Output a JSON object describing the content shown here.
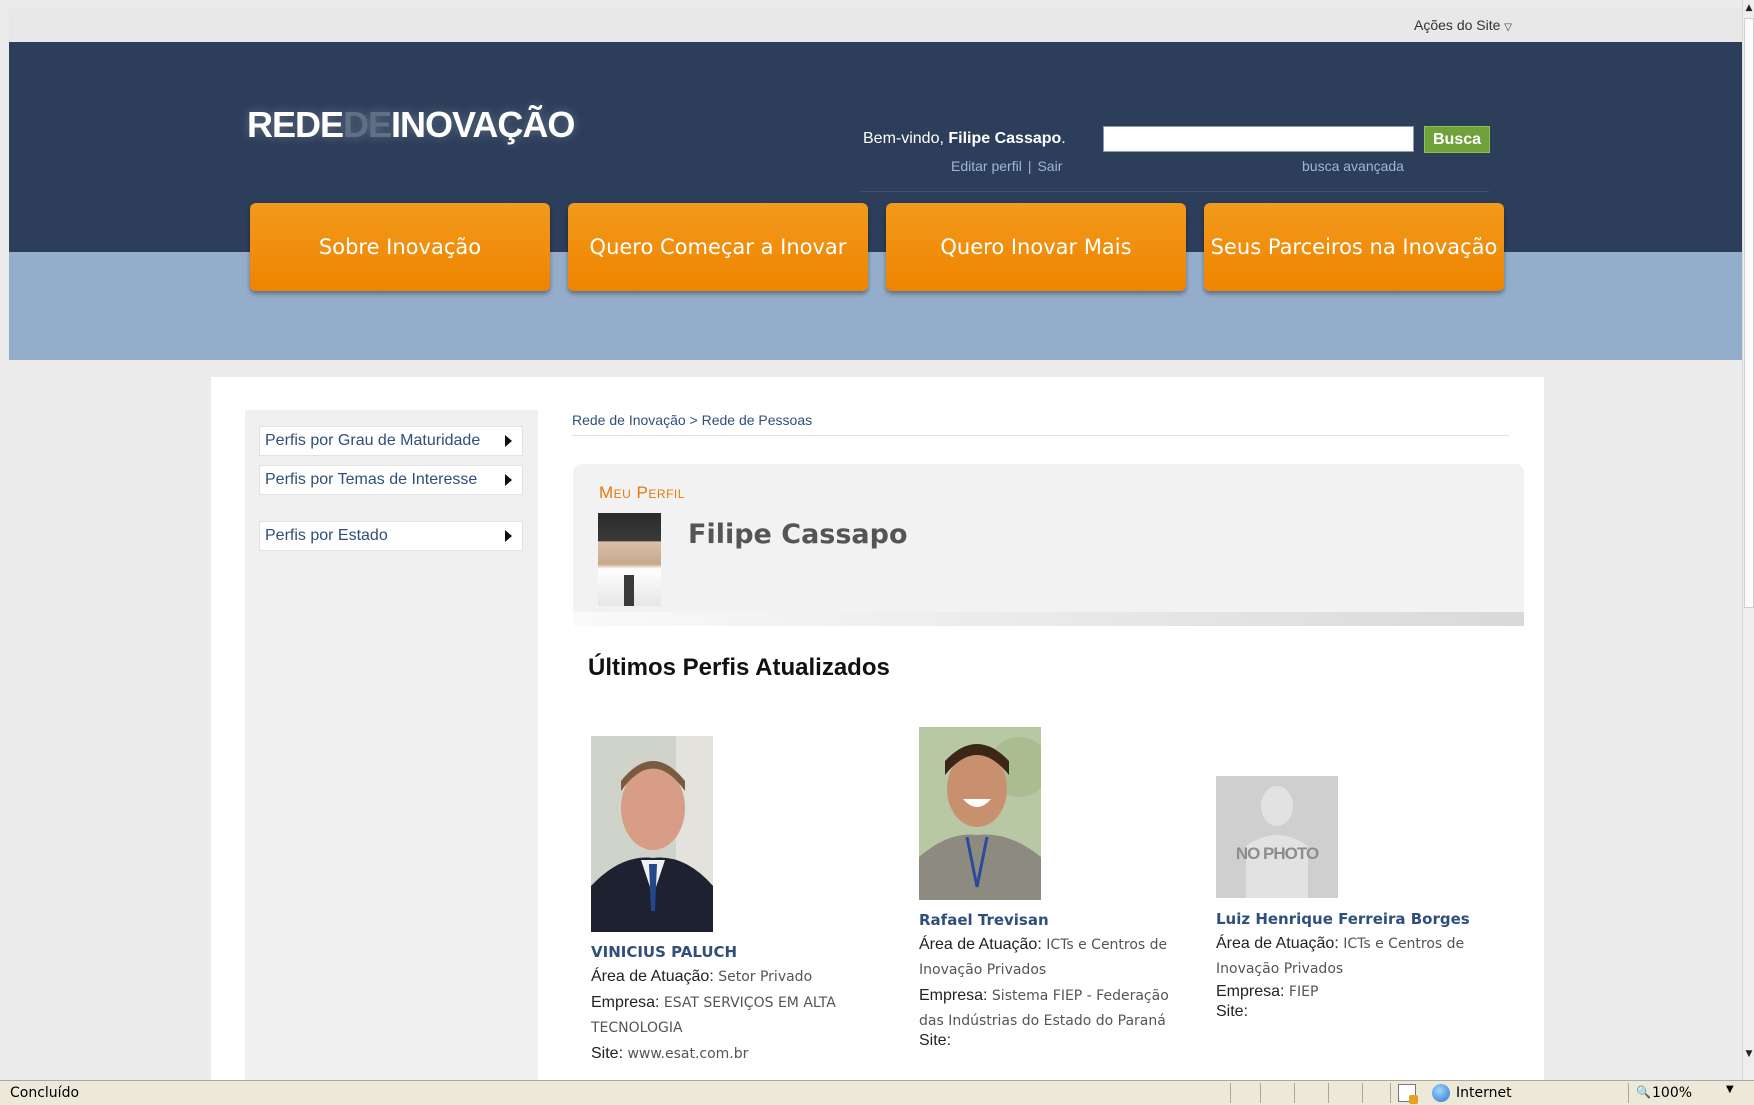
{
  "site_actions": "Ações do Site",
  "logo": {
    "part1": "REDE",
    "part2": "DE",
    "part3": "INOVAÇÃO"
  },
  "welcome": {
    "prefix": "Bem-vindo, ",
    "user": "Filipe Cassapo",
    "suffix": "."
  },
  "user_links": {
    "edit": "Editar perfil",
    "sep": "|",
    "logout": "Sair"
  },
  "search": {
    "button": "Busca",
    "advanced": "busca avançada",
    "value": ""
  },
  "nav": [
    {
      "label": "Sobre Inovação"
    },
    {
      "label": "Quero Começar a Inovar"
    },
    {
      "label": "Quero Inovar Mais"
    },
    {
      "label": "Seus Parceiros na Inovação"
    }
  ],
  "sidebar": {
    "items": [
      {
        "label": "Perfis por Grau de Maturidade"
      },
      {
        "label": "Perfis por Temas de Interesse"
      },
      {
        "label": "Perfis por Estado"
      }
    ]
  },
  "breadcrumb": {
    "root": "Rede de Inovação",
    "sep": ">",
    "current": "Rede de Pessoas"
  },
  "my_profile": {
    "title": "Meu Perfil",
    "name": "Filipe Cassapo"
  },
  "latest": {
    "title": "Últimos Perfis Atualizados",
    "cards": [
      {
        "name": "VINICIUS PALUCH",
        "area_label": "Área de Atuação:",
        "area": "Setor Privado",
        "company_label": "Empresa:",
        "company": "ESAT SERVIÇOS EM ALTA TECNOLOGIA",
        "site_label": "Site:",
        "site": "www.esat.com.br"
      },
      {
        "name": "Rafael Trevisan",
        "area_label": "Área de Atuação:",
        "area": "ICTs e Centros de Inovação Privados",
        "company_label": "Empresa:",
        "company": "Sistema FIEP - Federação das Indústrias do Estado do Paraná",
        "site_label": "Site:",
        "site": ""
      },
      {
        "name": "Luiz Henrique Ferreira Borges",
        "photo_text": "NO PHOTO",
        "area_label": "Área de Atuação:",
        "area": "ICTs e Centros de Inovação Privados",
        "company_label": "Empresa:",
        "company": "FIEP",
        "site_label": "Site:",
        "site": ""
      }
    ]
  },
  "statusbar": {
    "status": "Concluído",
    "zone": "Internet",
    "zoom": "100%"
  },
  "colors": {
    "header": "#2c3e5a",
    "band": "#93adcb",
    "nav": "#ef8400",
    "accent": "#e8780c",
    "link": "#2f4f7a",
    "search_btn": "#6fa23a"
  }
}
